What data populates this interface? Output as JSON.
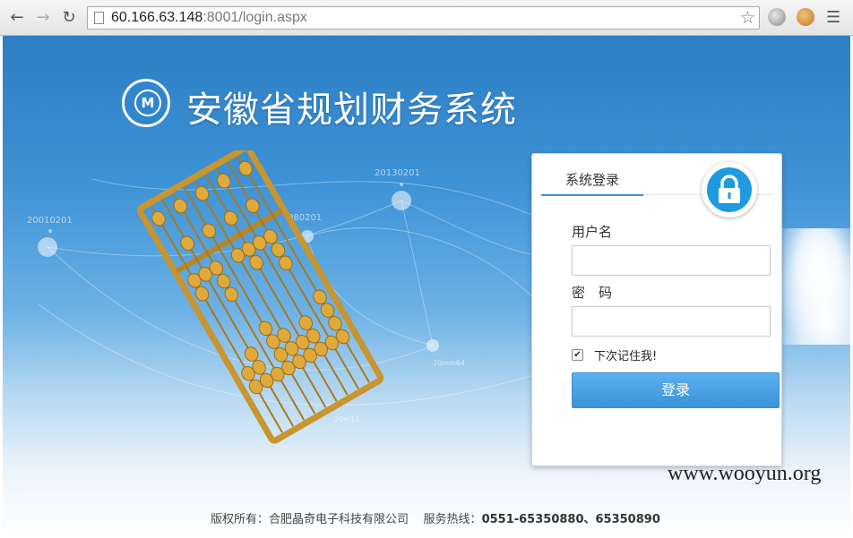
{
  "browser": {
    "url_host": "60.166.63.148",
    "url_rest": ":8001/login.aspx"
  },
  "header": {
    "title": "安徽省规划财务系统",
    "logo_glyph": "M"
  },
  "background_labels": [
    "20010201",
    "20130201",
    "080201",
    "20mm64",
    "20m12"
  ],
  "login": {
    "tab_label": "系统登录",
    "username_label": "用户名",
    "password_label": "密　码",
    "username_value": "",
    "password_value": "",
    "remember_checked": true,
    "remember_label": "下次记住我!",
    "submit_label": "登录"
  },
  "footer": {
    "copyright": "版权所有：合肥晶奇电子科技有限公司",
    "hotline_label": "服务热线：",
    "hotline_numbers": "0551-65350880、65350890"
  },
  "watermark": "www.wooyun.org",
  "colors": {
    "accent": "#3a92d8",
    "lock_blue": "#1e9be0",
    "page_top": "#2d7ec4"
  },
  "icons": [
    "back-arrow-icon",
    "forward-arrow-icon",
    "reload-icon",
    "page-icon",
    "star-icon",
    "globe-icon",
    "cookie-icon",
    "menu-icon",
    "lock-icon",
    "checkmark-icon"
  ]
}
